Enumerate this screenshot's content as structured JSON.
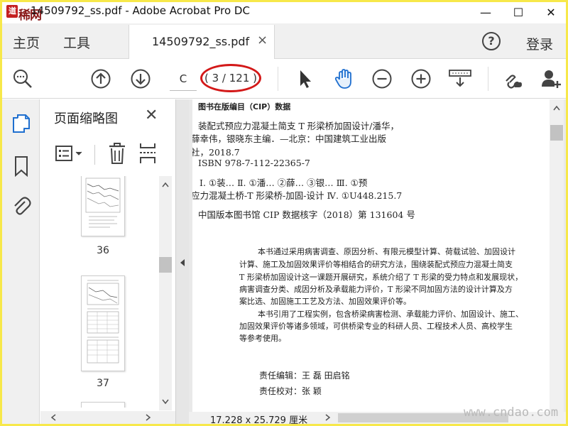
{
  "window": {
    "logo_text": "道 稀网",
    "title": "14509792_ss.pdf - Adobe Acrobat Pro DC",
    "minimize": "—",
    "maximize": "☐",
    "close": "✕"
  },
  "menu": {
    "home": "主页",
    "tools": "工具",
    "doc_tab": "14509792_ss.pdf",
    "doc_tab_close": "×",
    "help": "?",
    "login": "登录"
  },
  "toolbar": {
    "page_input_value": "C",
    "page_count": "( 3 / 121 )",
    "icons": [
      "search-zoom-icon",
      "page-up-icon",
      "page-down-icon",
      "select-arrow-icon",
      "hand-tool-icon",
      "zoom-out-icon",
      "zoom-in-icon",
      "read-mode-icon",
      "link-share-icon",
      "add-user-icon"
    ]
  },
  "rail": {
    "icons": [
      "page-thumbnails-icon",
      "bookmark-icon",
      "attachment-icon"
    ]
  },
  "panel": {
    "title": "页面缩略图",
    "close": "✕",
    "tool_icons": [
      "thumbnail-options-icon",
      "delete-page-icon",
      "extract-page-icon"
    ],
    "thumbnails": [
      {
        "label": "36"
      },
      {
        "label": "37"
      }
    ]
  },
  "document": {
    "lines": [
      "图书在版编目（CIP）数据",
      "装配式预应力混凝土简支 T 形梁桥加固设计/潘华，",
      "薛幸伟，银晓东主编．—北京：中国建筑工业出版",
      "社，2018.7",
      "ISBN 978-7-112-22365-7",
      "Ⅰ. ①装…  Ⅱ. ①潘… ②薛… ③银…  Ⅲ. ①预",
      "应力混凝土桥-T 形梁桥-加固-设计  Ⅳ. ①U448.215.7",
      "中国版本图书馆 CIP 数据核字（2018）第 131604 号",
      "本书通过采用病害调查、原因分析、有限元模型计算、荷载试验、加固设计",
      "计算、施工及加固效果评价等相结合的研究方法，围绕装配式预应力混凝土简支",
      "T 形梁桥加固设计这一课题开展研究，系统介绍了 T 形梁的受力特点和发展现状，",
      "病害调查分类、成因分析及承载能力评价，T 形梁不同加固方法的设计计算及方",
      "案比选、加固施工工艺及方法、加固效果评价等。",
      "本书引用了工程实例，包含桥梁病害检测、承载能力评价、加固设计、施工、",
      "加固效果评价等诸多领域，可供桥梁专业的科研人员、工程技术人员、高校学生",
      "等参考使用。",
      "责任编辑：王    磊    田启铭",
      "责任校对：张    颖"
    ],
    "page_size": "17.228 x 25.729 厘米"
  },
  "watermark": "www.cndao.com"
}
